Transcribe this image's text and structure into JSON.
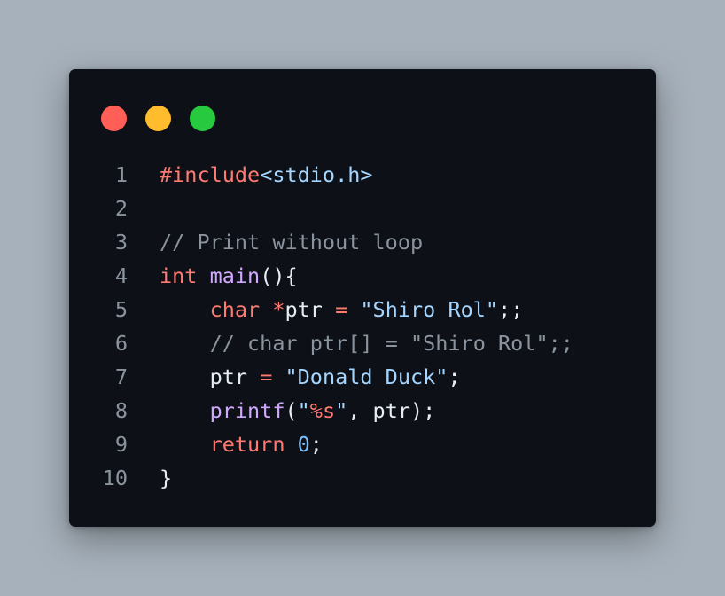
{
  "window": {
    "controls": {
      "close_color": "#ff5f56",
      "minimize_color": "#ffbd2e",
      "maximize_color": "#27c93f"
    }
  },
  "code": {
    "lines": [
      {
        "num": "1",
        "tokens": [
          {
            "t": "#include",
            "k": "pre"
          },
          {
            "t": "<stdio.h>",
            "k": "inc"
          }
        ]
      },
      {
        "num": "2",
        "tokens": []
      },
      {
        "num": "3",
        "tokens": [
          {
            "t": "// Print without loop",
            "k": "com"
          }
        ]
      },
      {
        "num": "4",
        "tokens": [
          {
            "t": "int",
            "k": "kw"
          },
          {
            "t": " ",
            "k": "pl"
          },
          {
            "t": "main",
            "k": "fn"
          },
          {
            "t": "(){",
            "k": "pl"
          }
        ]
      },
      {
        "num": "5",
        "tokens": [
          {
            "t": "    ",
            "k": "pl"
          },
          {
            "t": "char",
            "k": "kw"
          },
          {
            "t": " ",
            "k": "pl"
          },
          {
            "t": "*",
            "k": "op"
          },
          {
            "t": "ptr ",
            "k": "pl"
          },
          {
            "t": "=",
            "k": "op"
          },
          {
            "t": " ",
            "k": "pl"
          },
          {
            "t": "\"Shiro Rol\"",
            "k": "str"
          },
          {
            "t": ";;",
            "k": "pl"
          }
        ]
      },
      {
        "num": "6",
        "tokens": [
          {
            "t": "    // char ptr[] = \"Shiro Rol\";;",
            "k": "com"
          }
        ]
      },
      {
        "num": "7",
        "tokens": [
          {
            "t": "    ptr ",
            "k": "pl"
          },
          {
            "t": "=",
            "k": "op"
          },
          {
            "t": " ",
            "k": "pl"
          },
          {
            "t": "\"Donald Duck\"",
            "k": "str"
          },
          {
            "t": ";",
            "k": "pl"
          }
        ]
      },
      {
        "num": "8",
        "tokens": [
          {
            "t": "    ",
            "k": "pl"
          },
          {
            "t": "printf",
            "k": "fn"
          },
          {
            "t": "(",
            "k": "pl"
          },
          {
            "t": "\"",
            "k": "str"
          },
          {
            "t": "%s",
            "k": "fmt"
          },
          {
            "t": "\"",
            "k": "str"
          },
          {
            "t": ", ptr);",
            "k": "pl"
          }
        ]
      },
      {
        "num": "9",
        "tokens": [
          {
            "t": "    ",
            "k": "pl"
          },
          {
            "t": "return",
            "k": "kw"
          },
          {
            "t": " ",
            "k": "pl"
          },
          {
            "t": "0",
            "k": "num"
          },
          {
            "t": ";",
            "k": "pl"
          }
        ]
      },
      {
        "num": "10",
        "tokens": [
          {
            "t": "}",
            "k": "pl"
          }
        ]
      }
    ]
  }
}
